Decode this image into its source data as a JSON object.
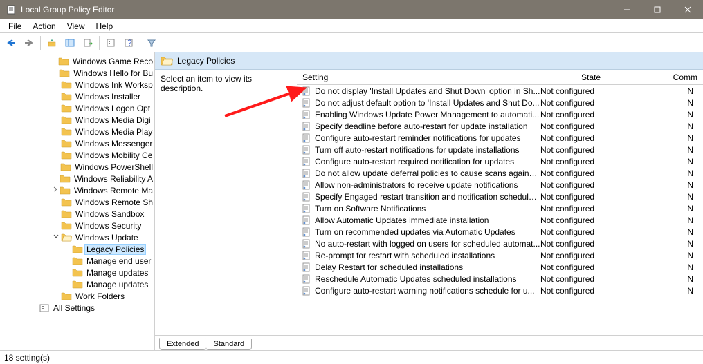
{
  "window": {
    "title": "Local Group Policy Editor"
  },
  "menubar": [
    "File",
    "Action",
    "View",
    "Help"
  ],
  "toolbar": {
    "back": "←",
    "fwd": "→"
  },
  "tree": {
    "items": [
      {
        "depth": 4,
        "twisty": "",
        "label": "Windows Game Reco"
      },
      {
        "depth": 4,
        "twisty": "",
        "label": "Windows Hello for Bu"
      },
      {
        "depth": 4,
        "twisty": "",
        "label": "Windows Ink Worksp"
      },
      {
        "depth": 4,
        "twisty": "",
        "label": "Windows Installer"
      },
      {
        "depth": 4,
        "twisty": "",
        "label": "Windows Logon Opt"
      },
      {
        "depth": 4,
        "twisty": "",
        "label": "Windows Media Digi"
      },
      {
        "depth": 4,
        "twisty": "",
        "label": "Windows Media Play"
      },
      {
        "depth": 4,
        "twisty": "",
        "label": "Windows Messenger"
      },
      {
        "depth": 4,
        "twisty": "",
        "label": "Windows Mobility Ce"
      },
      {
        "depth": 4,
        "twisty": "",
        "label": "Windows PowerShell"
      },
      {
        "depth": 4,
        "twisty": "",
        "label": "Windows Reliability A"
      },
      {
        "depth": 4,
        "twisty": ">",
        "label": "Windows Remote Ma"
      },
      {
        "depth": 4,
        "twisty": "",
        "label": "Windows Remote Sh"
      },
      {
        "depth": 4,
        "twisty": "",
        "label": "Windows Sandbox"
      },
      {
        "depth": 4,
        "twisty": "",
        "label": "Windows Security"
      },
      {
        "depth": 4,
        "twisty": "v",
        "label": "Windows Update",
        "open": true
      },
      {
        "depth": 5,
        "twisty": "",
        "label": "Legacy Policies",
        "selected": true
      },
      {
        "depth": 5,
        "twisty": "",
        "label": "Manage end user"
      },
      {
        "depth": 5,
        "twisty": "",
        "label": "Manage updates"
      },
      {
        "depth": 5,
        "twisty": "",
        "label": "Manage updates"
      },
      {
        "depth": 4,
        "twisty": "",
        "label": "Work Folders"
      },
      {
        "depth": 2,
        "twisty": "",
        "label": "All Settings",
        "icon": "settings"
      }
    ]
  },
  "main": {
    "header": "Legacy Policies",
    "desc_prompt": "Select an item to view its description.",
    "columns": {
      "setting": "Setting",
      "state": "State",
      "comment": "Comm"
    },
    "rows": [
      {
        "s": "Do not display 'Install Updates and Shut Down' option in Sh...",
        "st": "Not configured",
        "c": "N"
      },
      {
        "s": "Do not adjust default option to 'Install Updates and Shut Do...",
        "st": "Not configured",
        "c": "N"
      },
      {
        "s": "Enabling Windows Update Power Management to automati...",
        "st": "Not configured",
        "c": "N"
      },
      {
        "s": "Specify deadline before auto-restart for update installation",
        "st": "Not configured",
        "c": "N"
      },
      {
        "s": "Configure auto-restart reminder notifications for updates",
        "st": "Not configured",
        "c": "N"
      },
      {
        "s": "Turn off auto-restart notifications for update installations",
        "st": "Not configured",
        "c": "N"
      },
      {
        "s": "Configure auto-restart required notification for updates",
        "st": "Not configured",
        "c": "N"
      },
      {
        "s": "Do not allow update deferral policies to cause scans against ...",
        "st": "Not configured",
        "c": "N"
      },
      {
        "s": "Allow non-administrators to receive update notifications",
        "st": "Not configured",
        "c": "N"
      },
      {
        "s": "Specify Engaged restart transition and notification schedule ...",
        "st": "Not configured",
        "c": "N"
      },
      {
        "s": "Turn on Software Notifications",
        "st": "Not configured",
        "c": "N"
      },
      {
        "s": "Allow Automatic Updates immediate installation",
        "st": "Not configured",
        "c": "N"
      },
      {
        "s": "Turn on recommended updates via Automatic Updates",
        "st": "Not configured",
        "c": "N"
      },
      {
        "s": "No auto-restart with logged on users for scheduled automat...",
        "st": "Not configured",
        "c": "N"
      },
      {
        "s": "Re-prompt for restart with scheduled installations",
        "st": "Not configured",
        "c": "N"
      },
      {
        "s": "Delay Restart for scheduled installations",
        "st": "Not configured",
        "c": "N"
      },
      {
        "s": "Reschedule Automatic Updates scheduled installations",
        "st": "Not configured",
        "c": "N"
      },
      {
        "s": "Configure auto-restart warning notifications schedule for u...",
        "st": "Not configured",
        "c": "N"
      }
    ],
    "tabs": [
      "Extended",
      "Standard"
    ],
    "active_tab": 0
  },
  "statusbar": "18 setting(s)"
}
